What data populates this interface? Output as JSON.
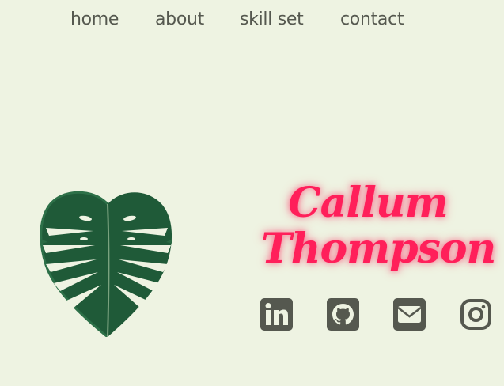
{
  "nav": {
    "home": "home",
    "about": "about",
    "skills": "skill set",
    "contact": "contact"
  },
  "hero": {
    "name_first": "Callum",
    "name_last": "Thompson",
    "name_color": "#ff1f5a"
  },
  "socials": [
    {
      "icon": "linkedin-icon"
    },
    {
      "icon": "github-icon"
    },
    {
      "icon": "email-icon"
    },
    {
      "icon": "instagram-icon"
    }
  ],
  "colors": {
    "background": "#eef3e2",
    "nav_text": "#55584f",
    "icon": "#55584f",
    "leaf": "#1f5a38"
  }
}
